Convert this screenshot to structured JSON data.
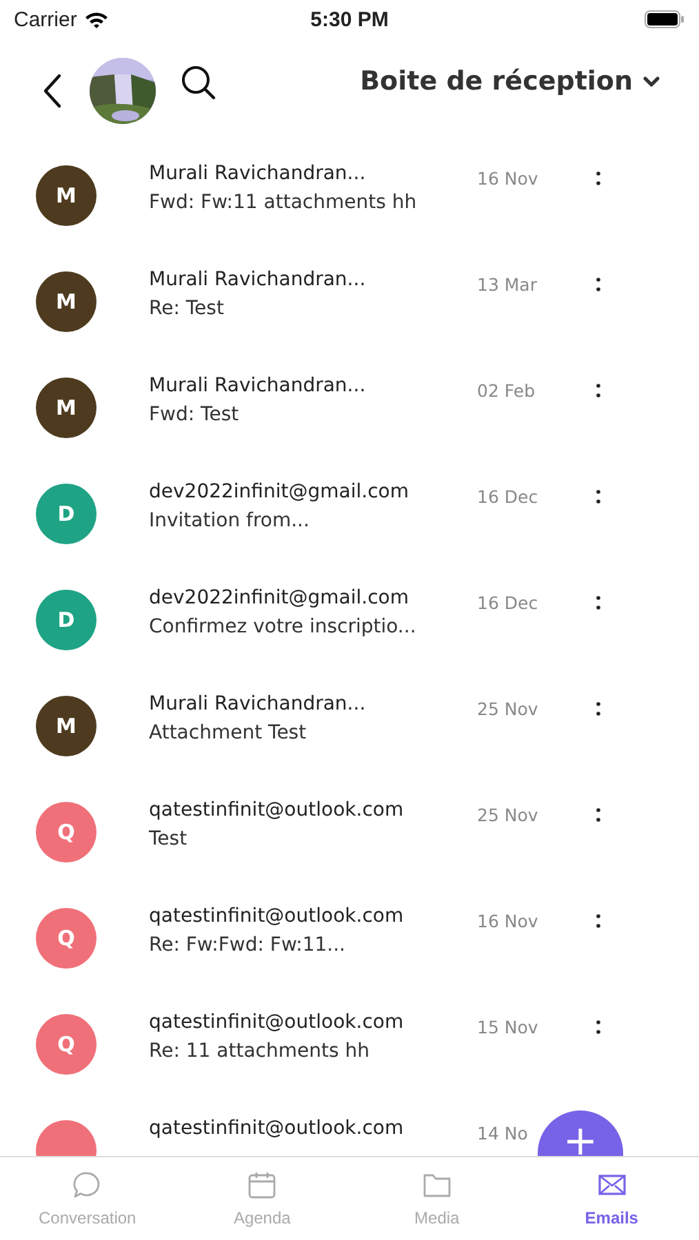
{
  "status_bar": {
    "carrier": "Carrier",
    "time": "5:30 PM"
  },
  "header": {
    "title": "Boite de réception"
  },
  "emails": [
    {
      "letter": "M",
      "color": "#4e3b1f",
      "sender": "Murali Ravichandran...",
      "subject": "Fwd: Fw:11 attachments hh",
      "date": "16 Nov"
    },
    {
      "letter": "M",
      "color": "#4e3b1f",
      "sender": "Murali Ravichandran...",
      "subject": "Re: Test",
      "date": "13 Mar"
    },
    {
      "letter": "M",
      "color": "#4e3b1f",
      "sender": "Murali Ravichandran...",
      "subject": "Fwd: Test",
      "date": "02 Feb"
    },
    {
      "letter": "D",
      "color": "#1fa385",
      "sender": "dev2022infinit@gmail.com",
      "subject": "Invitation from...",
      "date": "16 Dec"
    },
    {
      "letter": "D",
      "color": "#1fa385",
      "sender": "dev2022infinit@gmail.com",
      "subject": "Confirmez votre inscriptio...",
      "date": "16 Dec"
    },
    {
      "letter": "M",
      "color": "#4e3b1f",
      "sender": "Murali Ravichandran...",
      "subject": "Attachment Test",
      "date": "25 Nov"
    },
    {
      "letter": "Q",
      "color": "#f07079",
      "sender": "qatestinfinit@outlook.com",
      "subject": "Test",
      "date": "25 Nov"
    },
    {
      "letter": "Q",
      "color": "#f07079",
      "sender": "qatestinfinit@outlook.com",
      "subject": "Re: Fw:Fwd: Fw:11...",
      "date": "16 Nov"
    },
    {
      "letter": "Q",
      "color": "#f07079",
      "sender": "qatestinfinit@outlook.com",
      "subject": "Re: 11 attachments hh",
      "date": "15 Nov"
    },
    {
      "color": "#f07079",
      "sender": "qatestinfinit@outlook.com",
      "date": "14 No"
    }
  ],
  "fab": {
    "label": "+"
  },
  "tabs": [
    {
      "kind": "chat",
      "label": "Conversation",
      "selected": false
    },
    {
      "kind": "calendar",
      "label": "Agenda",
      "selected": false
    },
    {
      "kind": "folder",
      "label": "Media",
      "selected": false
    },
    {
      "kind": "mail",
      "label": "Emails",
      "selected": true
    }
  ]
}
